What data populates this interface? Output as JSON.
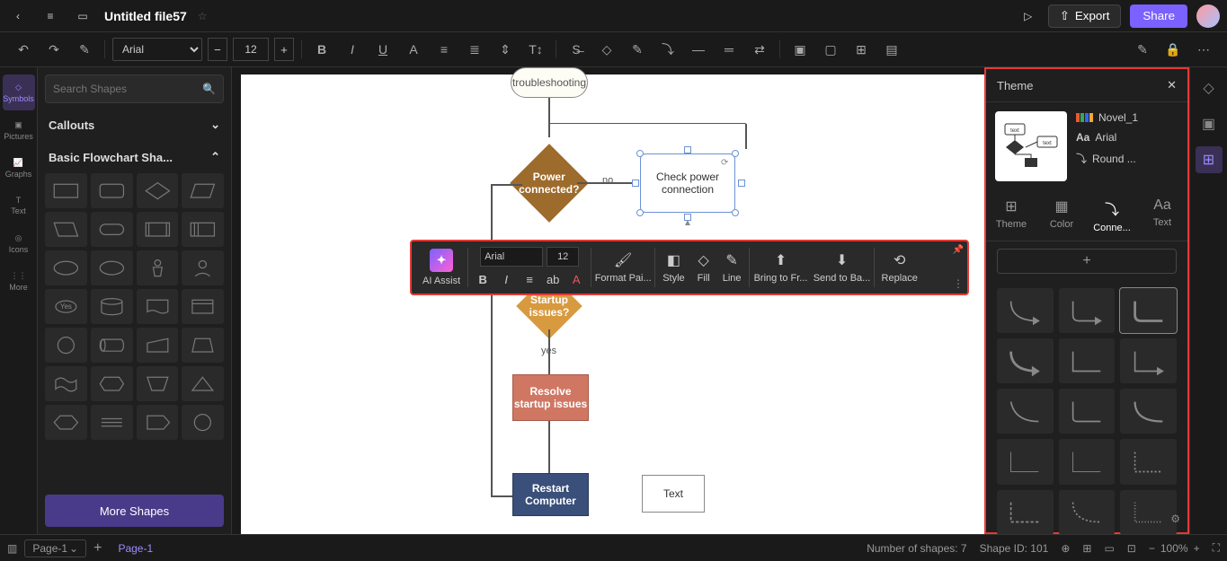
{
  "header": {
    "file_title": "Untitled file57",
    "export_label": "Export",
    "share_label": "Share"
  },
  "toolbar": {
    "font": "Arial",
    "font_size": "12"
  },
  "left_rail": {
    "items": [
      {
        "label": "Symbols",
        "active": true
      },
      {
        "label": "Pictures"
      },
      {
        "label": "Graphs"
      },
      {
        "label": "Text"
      },
      {
        "label": "Icons"
      },
      {
        "label": "More"
      }
    ]
  },
  "shapes_panel": {
    "search_placeholder": "Search Shapes",
    "sections": {
      "callouts": "Callouts",
      "basic": "Basic Flowchart Sha..."
    },
    "yes_label": "Yes",
    "more_shapes": "More Shapes"
  },
  "flowchart": {
    "troubleshoot": "troubleshooting",
    "power_connected": "Power connected?",
    "no_label": "no",
    "check_power": "Check power connection",
    "startup_issues": "Startup issues?",
    "yes_label": "yes",
    "resolve": "Resolve startup issues",
    "restart": "Restart Computer",
    "text_box": "Text"
  },
  "float_toolbar": {
    "ai_assist": "AI Assist",
    "font": "Arial",
    "font_size": "12",
    "format_painter": "Format Pai...",
    "style": "Style",
    "fill": "Fill",
    "line": "Line",
    "bring_to_front": "Bring to Fr...",
    "send_to_back": "Send to Ba...",
    "replace": "Replace"
  },
  "theme_panel": {
    "title": "Theme",
    "theme_name": "Novel_1",
    "font_name": "Arial",
    "connector_style": "Round ...",
    "tabs": {
      "theme": "Theme",
      "color": "Color",
      "connector": "Conne...",
      "text": "Text"
    }
  },
  "bottom": {
    "page_selector": "Page-1",
    "page_tab": "Page-1",
    "shapes_count": "Number of shapes: 7",
    "shape_id": "Shape ID: 101",
    "zoom": "100%"
  }
}
